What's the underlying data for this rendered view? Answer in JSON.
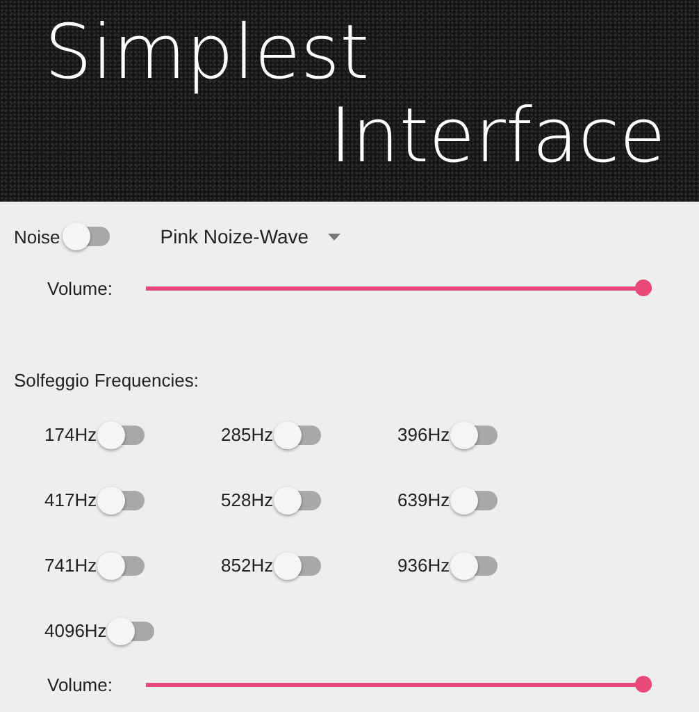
{
  "header": {
    "title_line_1": "Simplest",
    "title_line_2": "Interface"
  },
  "noise": {
    "label": "Noise",
    "on": false,
    "dropdown": "Pink Noize-Wave",
    "volume_label": "Volume:",
    "level": 1
  },
  "solfeggio": {
    "title": "Solfeggio Frequencies:",
    "frequencies": [
      {
        "label": "174Hz",
        "on": false
      },
      {
        "label": "285Hz",
        "on": false
      },
      {
        "label": "396Hz",
        "on": false
      },
      {
        "label": "417Hz",
        "on": false
      },
      {
        "label": "528Hz",
        "on": false
      },
      {
        "label": "639Hz",
        "on": false
      },
      {
        "label": "741Hz",
        "on": false
      },
      {
        "label": "852Hz",
        "on": false
      },
      {
        "label": "936Hz",
        "on": false
      },
      {
        "label": "4096Hz",
        "on": false
      }
    ],
    "volume_label": "Volume:",
    "level": 1
  }
}
